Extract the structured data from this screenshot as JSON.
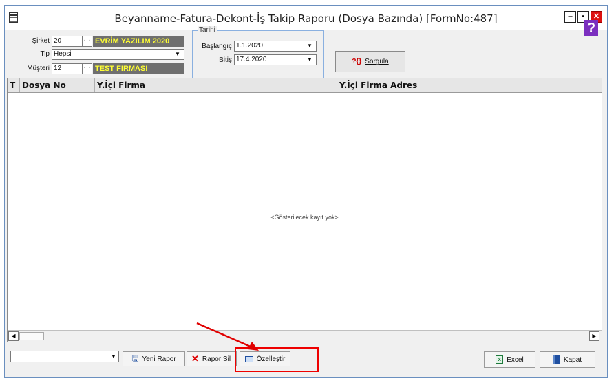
{
  "window": {
    "title": "Beyanname-Fatura-Dekont-İş Takip Raporu (Dosya Bazında) [FormNo:487]",
    "minimize_glyph": "‒",
    "maximize_glyph": "▪",
    "close_glyph": "✕",
    "help_glyph": "?"
  },
  "filters": {
    "sirket_label": "Şirket",
    "sirket_code": "20",
    "sirket_name": "EVRİM YAZILIM  2020",
    "tip_label": "Tip",
    "tip_value": "Hepsi",
    "musteri_label": "Müşteri",
    "musteri_code": "12",
    "musteri_name": "TEST FIRMASI",
    "ellipsis": "···"
  },
  "date_group": {
    "title": "Tarihi",
    "baslangic_label": "Başlangıç",
    "baslangic_value": "1.1.2020",
    "bitis_label": "Bitiş",
    "bitis_value": "17.4.2020"
  },
  "sorgula": {
    "label": "Sorgula",
    "icon": "?{}"
  },
  "grid": {
    "columns": [
      "T",
      "Dosya No",
      "Y.İçi Firma",
      "Y.İçi Firma Adres"
    ],
    "empty_message": "<Gösterilecek kayıt yok>"
  },
  "toolbar": {
    "combo_value": "",
    "yeni_rapor": "Yeni Rapor",
    "rapor_sil": "Rapor Sil",
    "ozellestir": "Özelleştir",
    "excel": "Excel",
    "kapat": "Kapat"
  },
  "colors": {
    "highlight_field_bg": "#6f6f6f",
    "highlight_field_text": "#ffff33",
    "annotation": "#e00000",
    "help_bg": "#7b2fbf"
  }
}
